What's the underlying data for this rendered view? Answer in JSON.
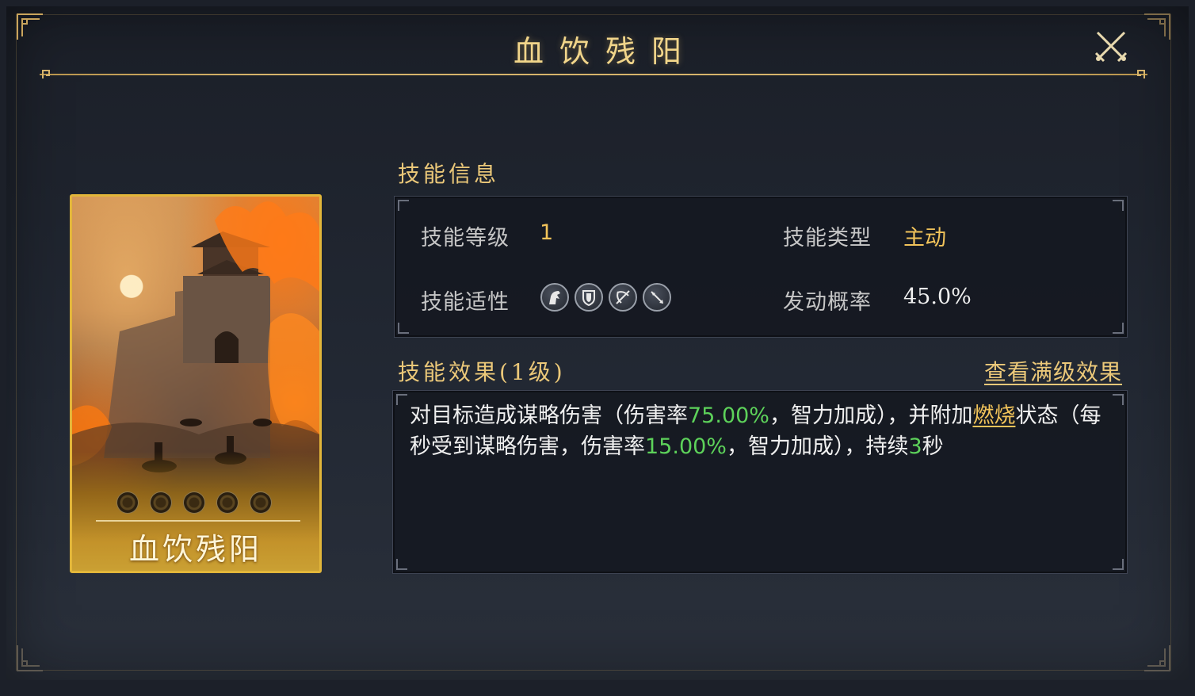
{
  "dialog": {
    "title": "血饮残阳"
  },
  "card": {
    "name": "血饮残阳",
    "star_slots": 5
  },
  "skill_info": {
    "heading": "技能信息",
    "level_label": "技能等级",
    "level_value": "1",
    "type_label": "技能类型",
    "type_value": "主动",
    "aptitude_label": "技能适性",
    "aptitude_icons": [
      "cavalry-icon",
      "shield-icon",
      "bow-icon",
      "spear-icon"
    ],
    "chance_label": "发动概率",
    "chance_value": "45.0%"
  },
  "skill_effect": {
    "heading": "技能效果(1级)",
    "view_full_label": "查看满级效果",
    "text_parts": [
      {
        "text": "对目标造成谋略伤害（伤害率",
        "style": "normal"
      },
      {
        "text": "75.00%",
        "style": "green"
      },
      {
        "text": "，智力加成），并附加",
        "style": "normal"
      },
      {
        "text": "燃烧",
        "style": "link"
      },
      {
        "text": "状态（每秒受到谋略伤害，伤害率",
        "style": "normal"
      },
      {
        "text": "15.00%",
        "style": "green"
      },
      {
        "text": "，智力加成），持续",
        "style": "normal"
      },
      {
        "text": "3",
        "style": "green"
      },
      {
        "text": "秒",
        "style": "normal"
      }
    ]
  },
  "colors": {
    "gold": "#ebc879",
    "highlight_green": "#5dd25a",
    "card_border": "#e2b63a"
  }
}
